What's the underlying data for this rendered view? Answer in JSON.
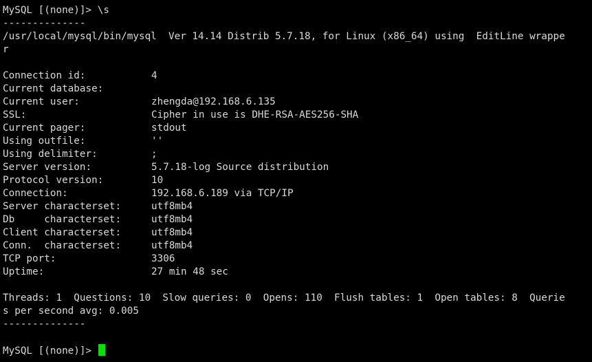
{
  "colors": {
    "background": "#000000",
    "text": "#d8d8d8",
    "cursor": "#00e600"
  },
  "terminal": {
    "command_line": "MySQL [(none)]> \\s",
    "separator": "--------------",
    "client_info_line1": "/usr/local/mysql/bin/mysql  Ver 14.14 Distrib 5.7.18, for Linux (x86_64) using  EditLine wrappe",
    "client_info_line2": "r",
    "status": [
      {
        "key": "Connection id:",
        "value": "4"
      },
      {
        "key": "Current database:",
        "value": ""
      },
      {
        "key": "Current user:",
        "value": "zhengda@192.168.6.135"
      },
      {
        "key": "SSL:",
        "value": "Cipher in use is DHE-RSA-AES256-SHA"
      },
      {
        "key": "Current pager:",
        "value": "stdout"
      },
      {
        "key": "Using outfile:",
        "value": "''"
      },
      {
        "key": "Using delimiter:",
        "value": ";"
      },
      {
        "key": "Server version:",
        "value": "5.7.18-log Source distribution"
      },
      {
        "key": "Protocol version:",
        "value": "10"
      },
      {
        "key": "Connection:",
        "value": "192.168.6.189 via TCP/IP"
      },
      {
        "key": "Server characterset:",
        "value": "utf8mb4"
      },
      {
        "key": "Db     characterset:",
        "value": "utf8mb4"
      },
      {
        "key": "Client characterset:",
        "value": "utf8mb4"
      },
      {
        "key": "Conn.  characterset:",
        "value": "utf8mb4"
      },
      {
        "key": "TCP port:",
        "value": "3306"
      },
      {
        "key": "Uptime:",
        "value": "27 min 48 sec"
      }
    ],
    "threads_line1": "Threads: 1  Questions: 10  Slow queries: 0  Opens: 110  Flush tables: 1  Open tables: 8  Querie",
    "threads_line2": "s per second avg: 0.005",
    "prompt": "MySQL [(none)]> "
  }
}
